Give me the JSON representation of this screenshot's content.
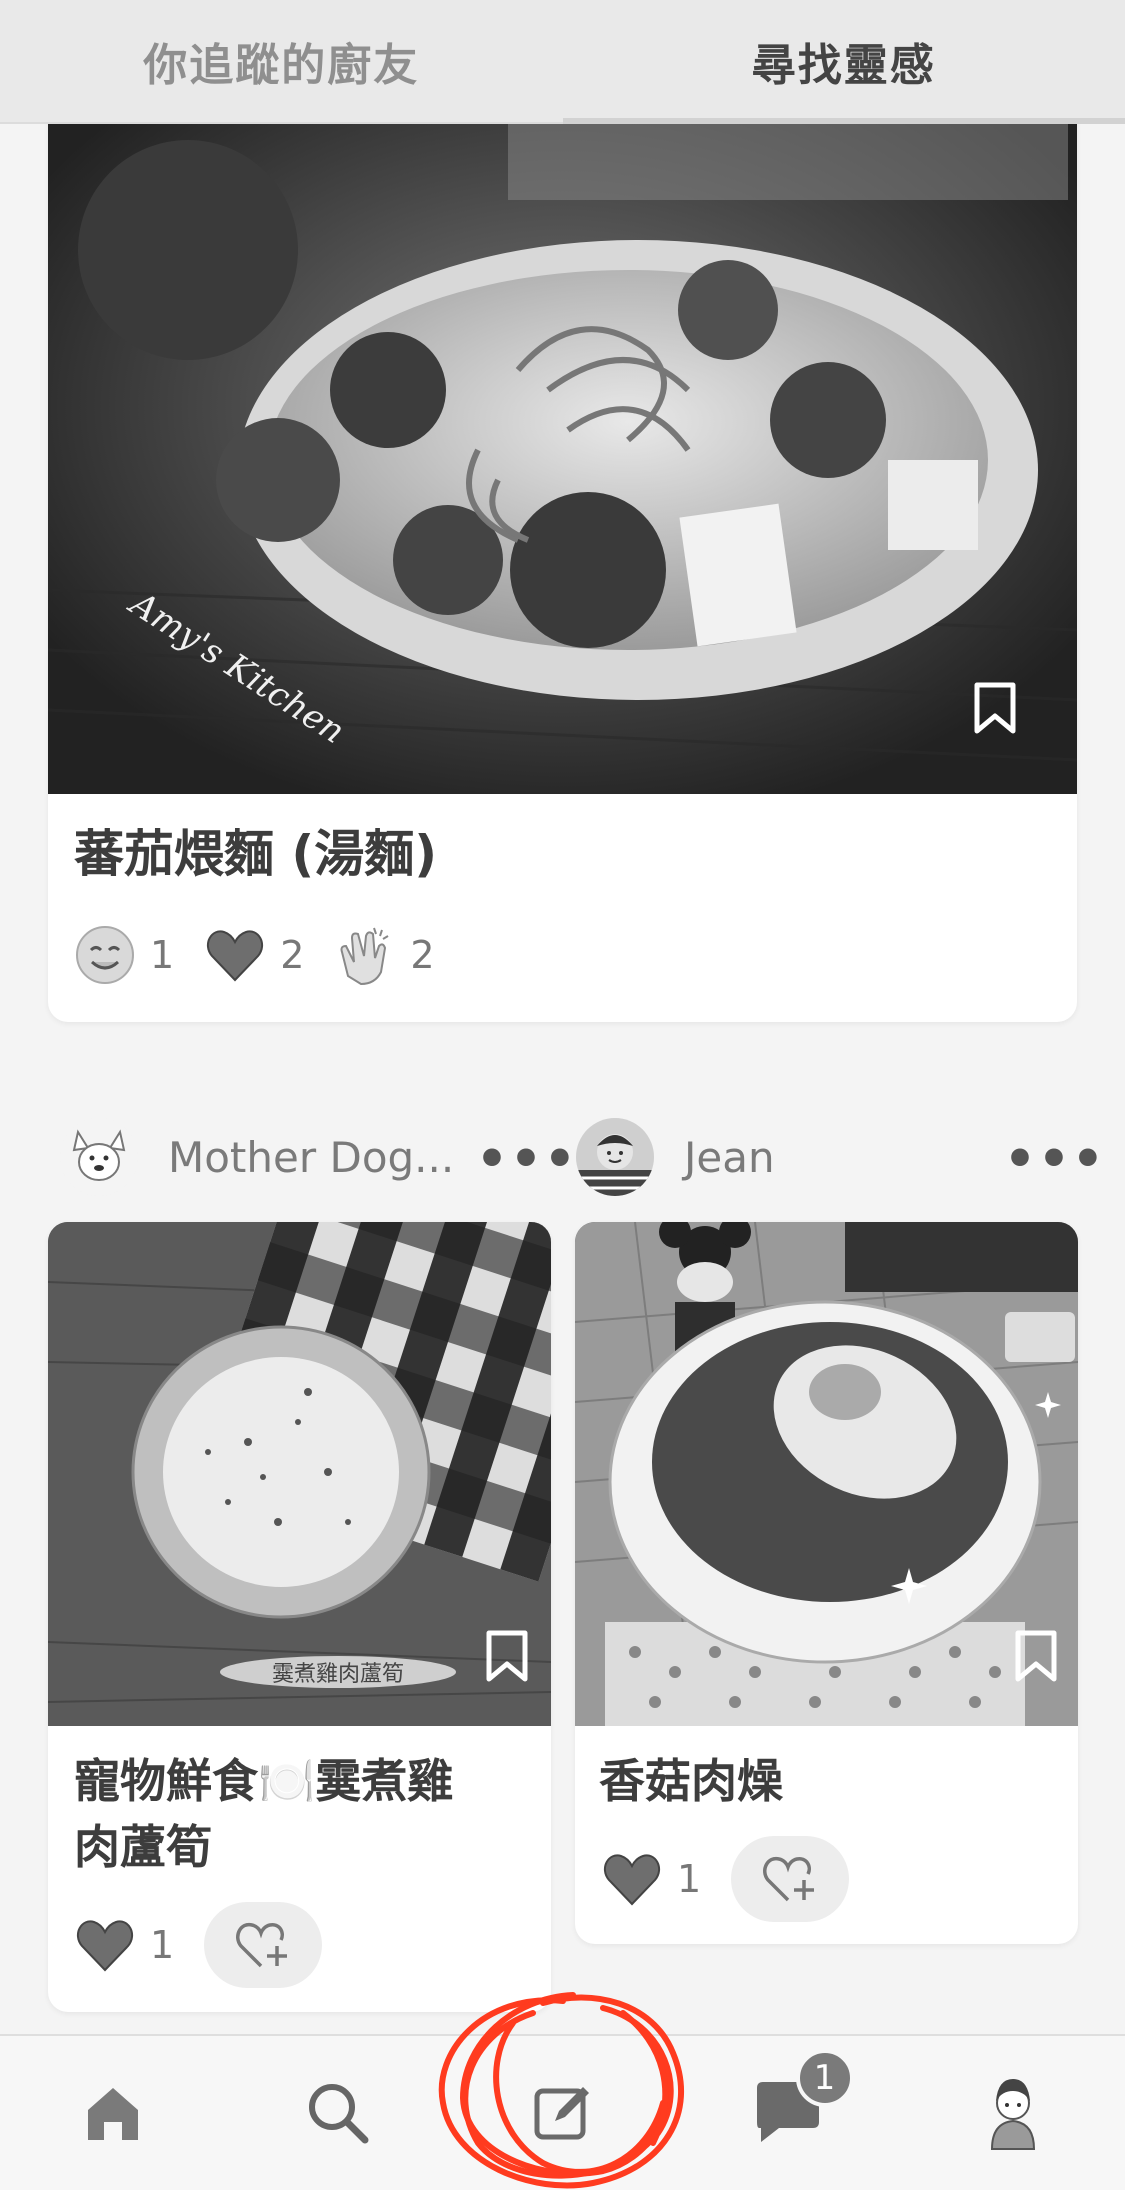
{
  "tabs": {
    "following": "你追蹤的廚友",
    "discover": "尋找靈感"
  },
  "main_card": {
    "title": "蕃茄煨麵 (湯麵)",
    "watermark": "Amy's Kitchen",
    "reactions": [
      {
        "icon": "yum-face-icon",
        "count": "1"
      },
      {
        "icon": "heart-icon",
        "count": "2"
      },
      {
        "icon": "clap-icon",
        "count": "2"
      }
    ]
  },
  "posts": [
    {
      "author": "Mother Dog...",
      "title_line1": "寵物鮮食🍽️霙煮雞",
      "title_line2": "肉蘆筍",
      "photo_caption": "霙煮雞肉蘆筍",
      "heart_count": "1"
    },
    {
      "author": "Jean",
      "title_line1": "香菇肉燥",
      "heart_count": "1"
    }
  ],
  "more_label": "•••",
  "nav": {
    "items": [
      "home-icon",
      "search-icon",
      "compose-icon",
      "chat-icon",
      "profile-icon"
    ],
    "chat_badge": "1"
  }
}
